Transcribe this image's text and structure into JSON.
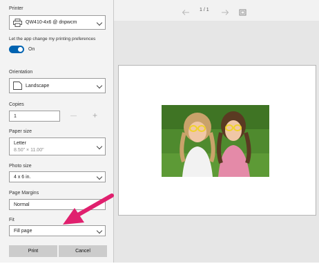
{
  "printer": {
    "label": "Printer",
    "value": "QW410-4x6 @ dnpwcm"
  },
  "app_pref": {
    "label": "Let the app change my printing preferences",
    "toggle_text": "On",
    "toggle_on": true
  },
  "orientation": {
    "label": "Orientation",
    "value": "Landscape"
  },
  "copies": {
    "label": "Copies",
    "value": "1",
    "minus": "—",
    "plus": "+"
  },
  "paper_size": {
    "label": "Paper size",
    "value": "Letter",
    "sub": "8.50\" × 11.00\""
  },
  "photo_size": {
    "label": "Photo size",
    "value": "4 x 6 in."
  },
  "margins": {
    "label": "Page Margins",
    "value": "Normal"
  },
  "fit": {
    "label": "Fit",
    "value": "Fill page"
  },
  "buttons": {
    "print": "Print",
    "cancel": "Cancel"
  },
  "preview": {
    "page_indicator": "1 / 1"
  },
  "colors": {
    "accent": "#0063b1",
    "annotation_arrow": "#e0206e"
  },
  "icons": [
    "printer-icon",
    "page-icon",
    "chevron-down-icon",
    "arrow-left-icon",
    "arrow-right-icon",
    "fit-view-icon",
    "annotation-arrow"
  ]
}
